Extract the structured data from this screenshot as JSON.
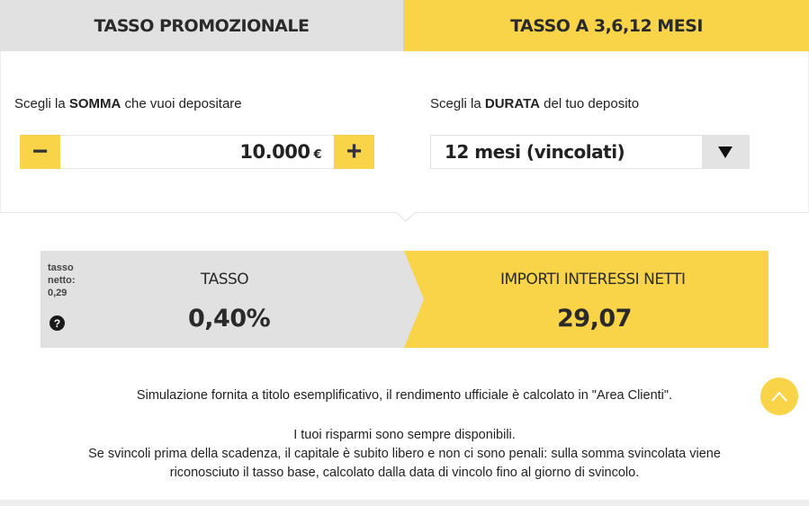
{
  "tabs": [
    {
      "label": "TASSO PROMOZIONALE",
      "active": false
    },
    {
      "label": "TASSO A 3,6,12 MESI",
      "active": true
    }
  ],
  "somma": {
    "label_prefix": "Scegli la ",
    "label_bold": "SOMMA",
    "label_suffix": " vuoi depositare",
    "label_middle": " che",
    "value": "10.000",
    "currency": "€",
    "minus_symbol": "−",
    "plus_symbol": "+"
  },
  "durata": {
    "label_prefix": "Scegli la ",
    "label_bold": "DURATA",
    "label_suffix": " del tuo deposito",
    "selected": "12 mesi (vincolati)",
    "arrow_icon": "triangle-down"
  },
  "results": {
    "tasso_netto_label": "tasso netto:",
    "tasso_netto_value": "0,29",
    "help_symbol": "?",
    "tasso_title": "TASSO",
    "tasso_value": "0,40%",
    "importi_title": "IMPORTI INTERESSI NETTI",
    "importi_value": "29,07"
  },
  "notes": {
    "simulation": "Simulazione fornita a titolo esemplificativo, il rendimento ufficiale è calcolato in \"Area Clienti\".",
    "line1": "I tuoi risparmi sono sempre disponibili.",
    "line2": "Se svincoli prima della scadenza, il capitale è subito libero e non ci sono penali: sulla somma svincolata viene",
    "line3": "riconosciuto il tasso base, calcolato dalla data di vincolo fino al giorno di svincolo."
  },
  "colors": {
    "accent": "#f9d448",
    "inactive_tab": "#e1e1e1",
    "text": "#222222"
  }
}
